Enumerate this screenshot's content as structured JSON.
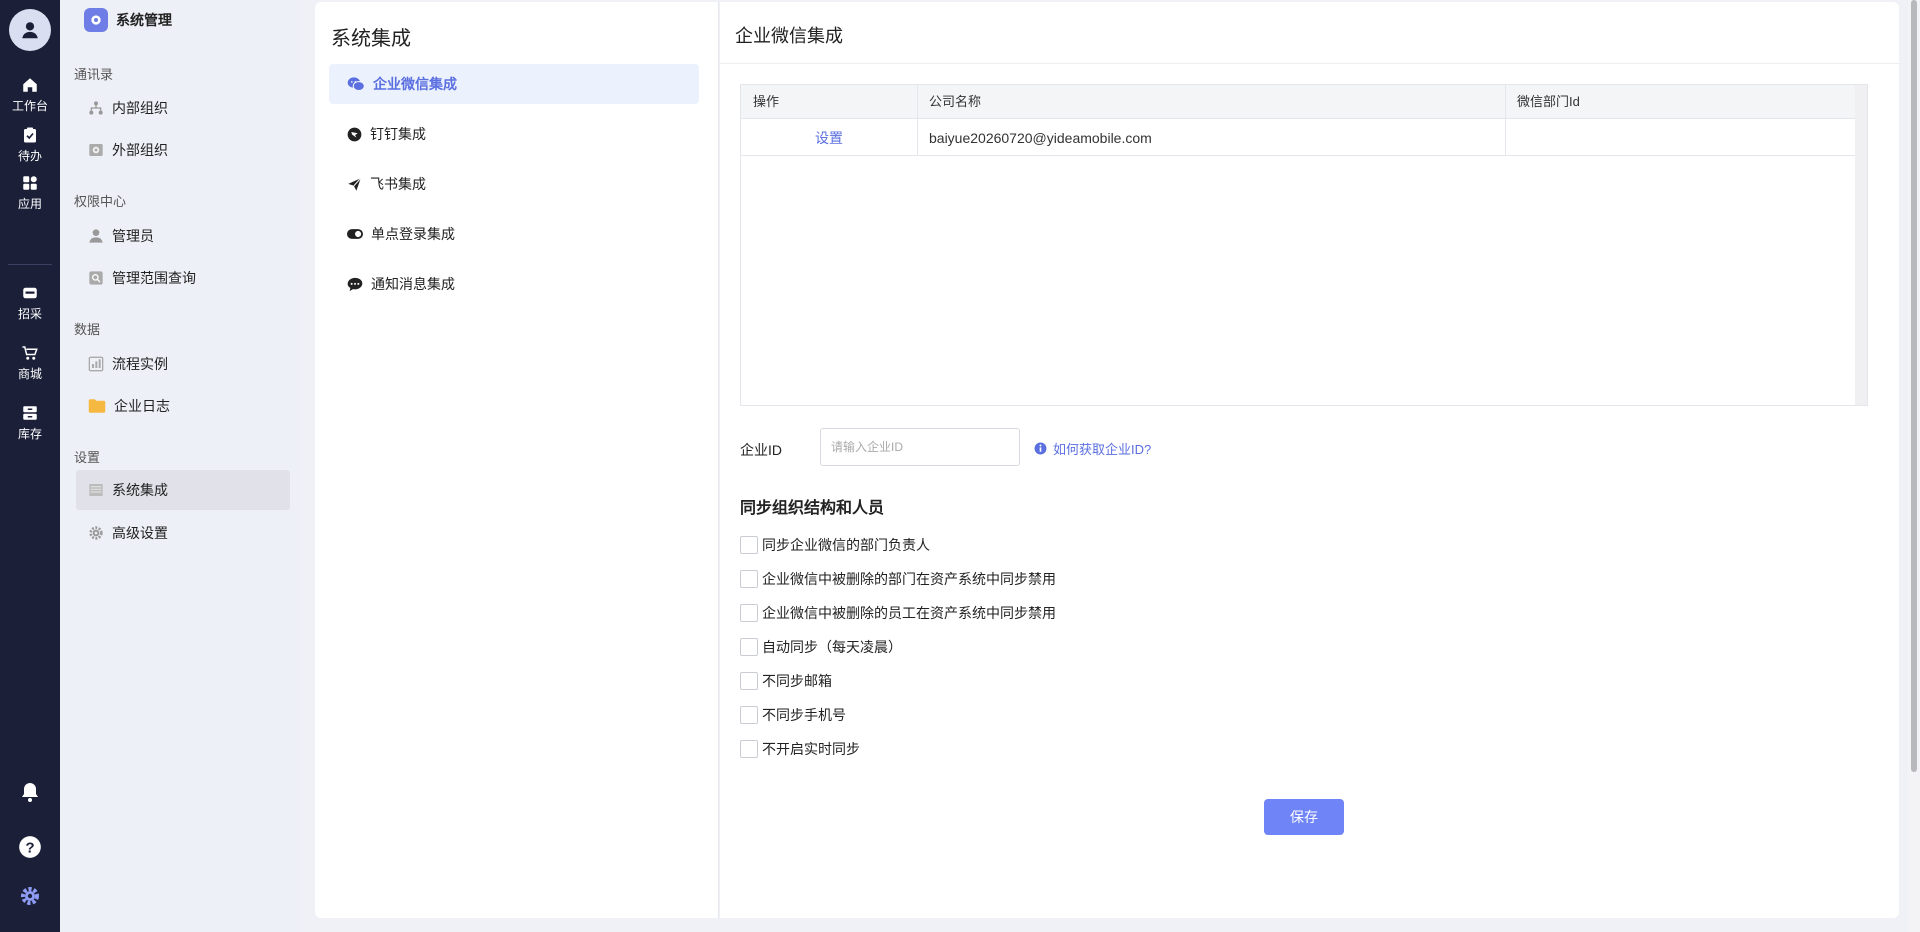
{
  "rail": {
    "items": [
      {
        "label": "工作台",
        "icon": "home-icon"
      },
      {
        "label": "待办",
        "icon": "clipboard-check-icon"
      },
      {
        "label": "应用",
        "icon": "apps-icon"
      },
      {
        "label": "招采",
        "icon": "srm-icon"
      },
      {
        "label": "商城",
        "icon": "cart-icon"
      },
      {
        "label": "库存",
        "icon": "inventory-icon"
      }
    ],
    "bottom_icons": [
      "bell-icon",
      "help-icon",
      "settings-icon"
    ]
  },
  "sidebar": {
    "brand": "系统管理",
    "groups": [
      {
        "title": "通讯录",
        "items": [
          {
            "label": "内部组织",
            "icon": "org-tree-icon"
          },
          {
            "label": "外部组织",
            "icon": "external-org-icon"
          }
        ]
      },
      {
        "title": "权限中心",
        "items": [
          {
            "label": "管理员",
            "icon": "admin-user-icon"
          },
          {
            "label": "管理范围查询",
            "icon": "search-scope-icon"
          }
        ]
      },
      {
        "title": "数据",
        "items": [
          {
            "label": "流程实例",
            "icon": "flow-chart-icon"
          },
          {
            "label": "企业日志",
            "icon": "folder-icon"
          }
        ]
      },
      {
        "title": "设置",
        "items": [
          {
            "label": "系统集成",
            "icon": "integration-icon",
            "active": true
          },
          {
            "label": "高级设置",
            "icon": "gear-icon"
          }
        ]
      }
    ]
  },
  "mid": {
    "title": "系统集成",
    "items": [
      {
        "label": "企业微信集成",
        "icon": "wechat-work-icon",
        "active": true
      },
      {
        "label": "钉钉集成",
        "icon": "dingtalk-icon"
      },
      {
        "label": "飞书集成",
        "icon": "feishu-icon"
      },
      {
        "label": "单点登录集成",
        "icon": "toggle-icon"
      },
      {
        "label": "通知消息集成",
        "icon": "message-icon"
      }
    ]
  },
  "main": {
    "title": "企业微信集成",
    "table": {
      "columns": [
        "操作",
        "公司名称",
        "微信部门Id"
      ],
      "rows": [
        {
          "action": "设置",
          "company": "baiyue20260720@yideamobile.com",
          "dept_id": ""
        }
      ]
    },
    "form": {
      "corp_id_label": "企业ID",
      "corp_id_placeholder": "请输入企业ID",
      "help_link": "如何获取企业ID?"
    },
    "sync": {
      "title": "同步组织结构和人员",
      "options": [
        "同步企业微信的部门负责人",
        "企业微信中被删除的部门在资产系统中同步禁用",
        "企业微信中被删除的员工在资产系统中同步禁用",
        "自动同步（每天凌晨）",
        "不同步邮箱",
        "不同步手机号",
        "不开启实时同步"
      ]
    },
    "save_label": "保存"
  },
  "colors": {
    "rail_bg": "#1b2038",
    "accent": "#6f84f6",
    "link": "#5b6fe0",
    "active_bg": "#ebf2fd"
  }
}
